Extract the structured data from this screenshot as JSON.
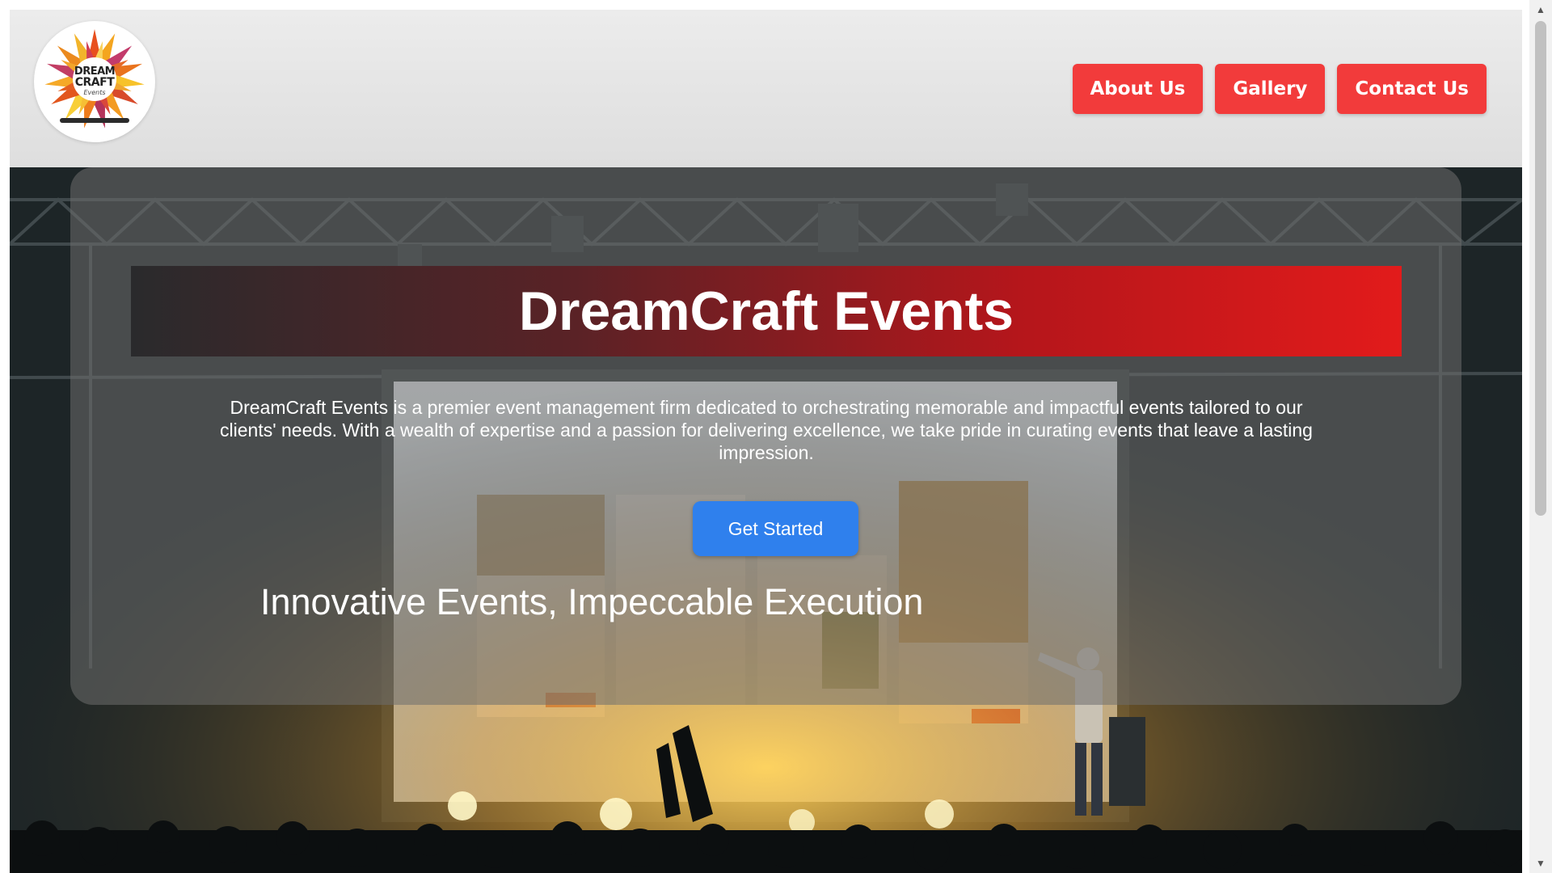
{
  "brand": {
    "logo_line1": "DREAM",
    "logo_line2": "CRAFT",
    "logo_line3": "Events"
  },
  "nav": {
    "items": [
      {
        "label": "About Us"
      },
      {
        "label": "Gallery"
      },
      {
        "label": "Contact Us"
      }
    ]
  },
  "hero": {
    "title": "DreamCraft Events",
    "description": "DreamCraft Events is a premier event management firm dedicated to orchestrating memorable and impactful events tailored to our clients' needs. With a wealth of expertise and a passion for delivering excellence, we take pride in curating events that leave a lasting impression.",
    "cta_label": "Get Started",
    "tagline": "Innovative Events, Impeccable Execution"
  },
  "colors": {
    "nav_button": "#f23b3b",
    "cta_button": "#2f80ed",
    "banner_start": "#2a2a2c",
    "banner_end": "#e21b1b"
  }
}
